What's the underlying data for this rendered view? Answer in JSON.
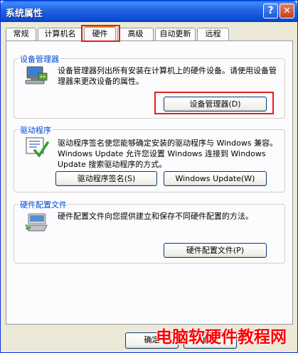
{
  "window": {
    "title": "系统属性",
    "help_glyph": "?",
    "close_glyph": "✕"
  },
  "tabs": [
    {
      "label": "常规",
      "active": false
    },
    {
      "label": "计算机名",
      "active": false
    },
    {
      "label": "硬件",
      "active": true
    },
    {
      "label": "高级",
      "active": false
    },
    {
      "label": "自动更新",
      "active": false
    },
    {
      "label": "远程",
      "active": false
    }
  ],
  "device_manager": {
    "title": "设备管理器",
    "description": "设备管理器列出所有安装在计算机上的硬件设备。请使用设备管理器来更改设备的属性。",
    "button_label": "设备管理器(D)",
    "icon": "device-manager-icon"
  },
  "drivers": {
    "title": "驱动程序",
    "description": "驱动程序签名使您能够确定安装的驱动程序与 Windows 兼容。Windows Update 允许您设置 Windows 连接到 Windows Update 搜索驱动程序的方式。",
    "signing_button_label": "驱动程序签名(S)",
    "update_button_label": "Windows Update(W)",
    "icon": "driver-checklist-icon"
  },
  "hardware_profiles": {
    "title": "硬件配置文件",
    "description": "硬件配置文件向您提供建立和保存不同硬件配置的方法。",
    "button_label": "硬件配置文件(P)",
    "icon": "hardware-profile-icon"
  },
  "footer": {
    "ok_label": "确定",
    "cancel_label": "取消"
  },
  "watermark": "电脑软硬件教程网",
  "colors": {
    "title_bar": "#0b4cd5",
    "group_title": "#0046d5",
    "highlight": "#e0201c",
    "watermark": "#ff0000"
  }
}
